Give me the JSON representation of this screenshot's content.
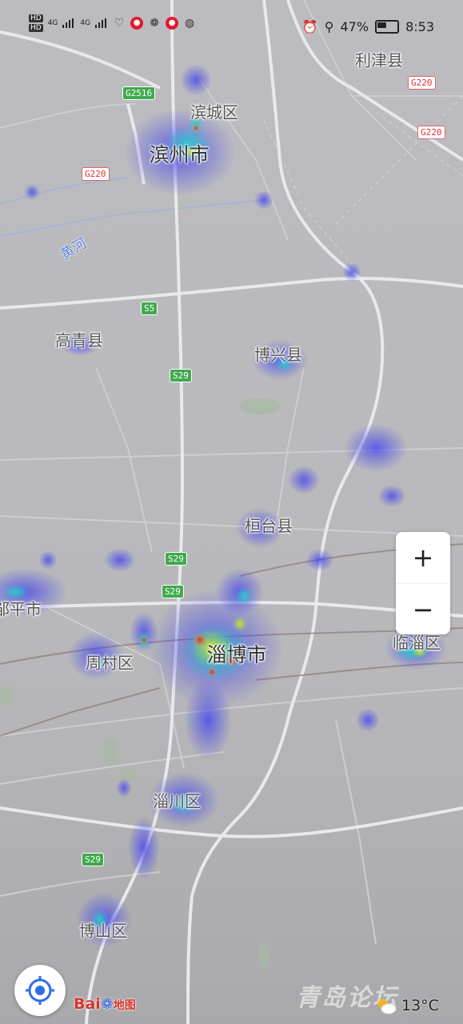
{
  "status_bar": {
    "hd1": "HD",
    "hd2": "HD",
    "net1": "4G",
    "net2": "4G",
    "battery": "47%",
    "time": "8:53",
    "icons": [
      "alarm-icon",
      "location-icon",
      "battery-icon"
    ],
    "apps": [
      "heart-app-icon",
      "weibo-icon",
      "wechat-icon",
      "weibo-icon",
      "browser-icon"
    ]
  },
  "map": {
    "places": [
      {
        "id": "lijin",
        "name": "利津县",
        "type": "county"
      },
      {
        "id": "bincheng",
        "name": "滨城区",
        "type": "county"
      },
      {
        "id": "binzhou",
        "name": "滨州市",
        "type": "city"
      },
      {
        "id": "gaoqing",
        "name": "高青县",
        "type": "county"
      },
      {
        "id": "boxing",
        "name": "博兴县",
        "type": "county"
      },
      {
        "id": "huantai",
        "name": "桓台县",
        "type": "county"
      },
      {
        "id": "zouping",
        "name": "邹平市",
        "type": "county"
      },
      {
        "id": "zhoucun",
        "name": "周村区",
        "type": "county"
      },
      {
        "id": "zibo",
        "name": "淄博市",
        "type": "city"
      },
      {
        "id": "linzi",
        "name": "临淄区",
        "type": "county"
      },
      {
        "id": "zichuan",
        "name": "淄川区",
        "type": "county"
      },
      {
        "id": "boshan",
        "name": "博山区",
        "type": "county"
      }
    ],
    "river": "黄河",
    "shields": [
      "G2516",
      "G220",
      "G220",
      "G220",
      "S5",
      "S29",
      "S29",
      "S29",
      "S29"
    ]
  },
  "controls": {
    "zoom_in": "+",
    "zoom_out": "−"
  },
  "brand": {
    "bai": "Bai",
    "du": "du",
    "ditu": "地图"
  },
  "weather": {
    "temp": "13°C",
    "icon": "partly-cloudy-icon"
  },
  "watermark": "青岛论坛"
}
